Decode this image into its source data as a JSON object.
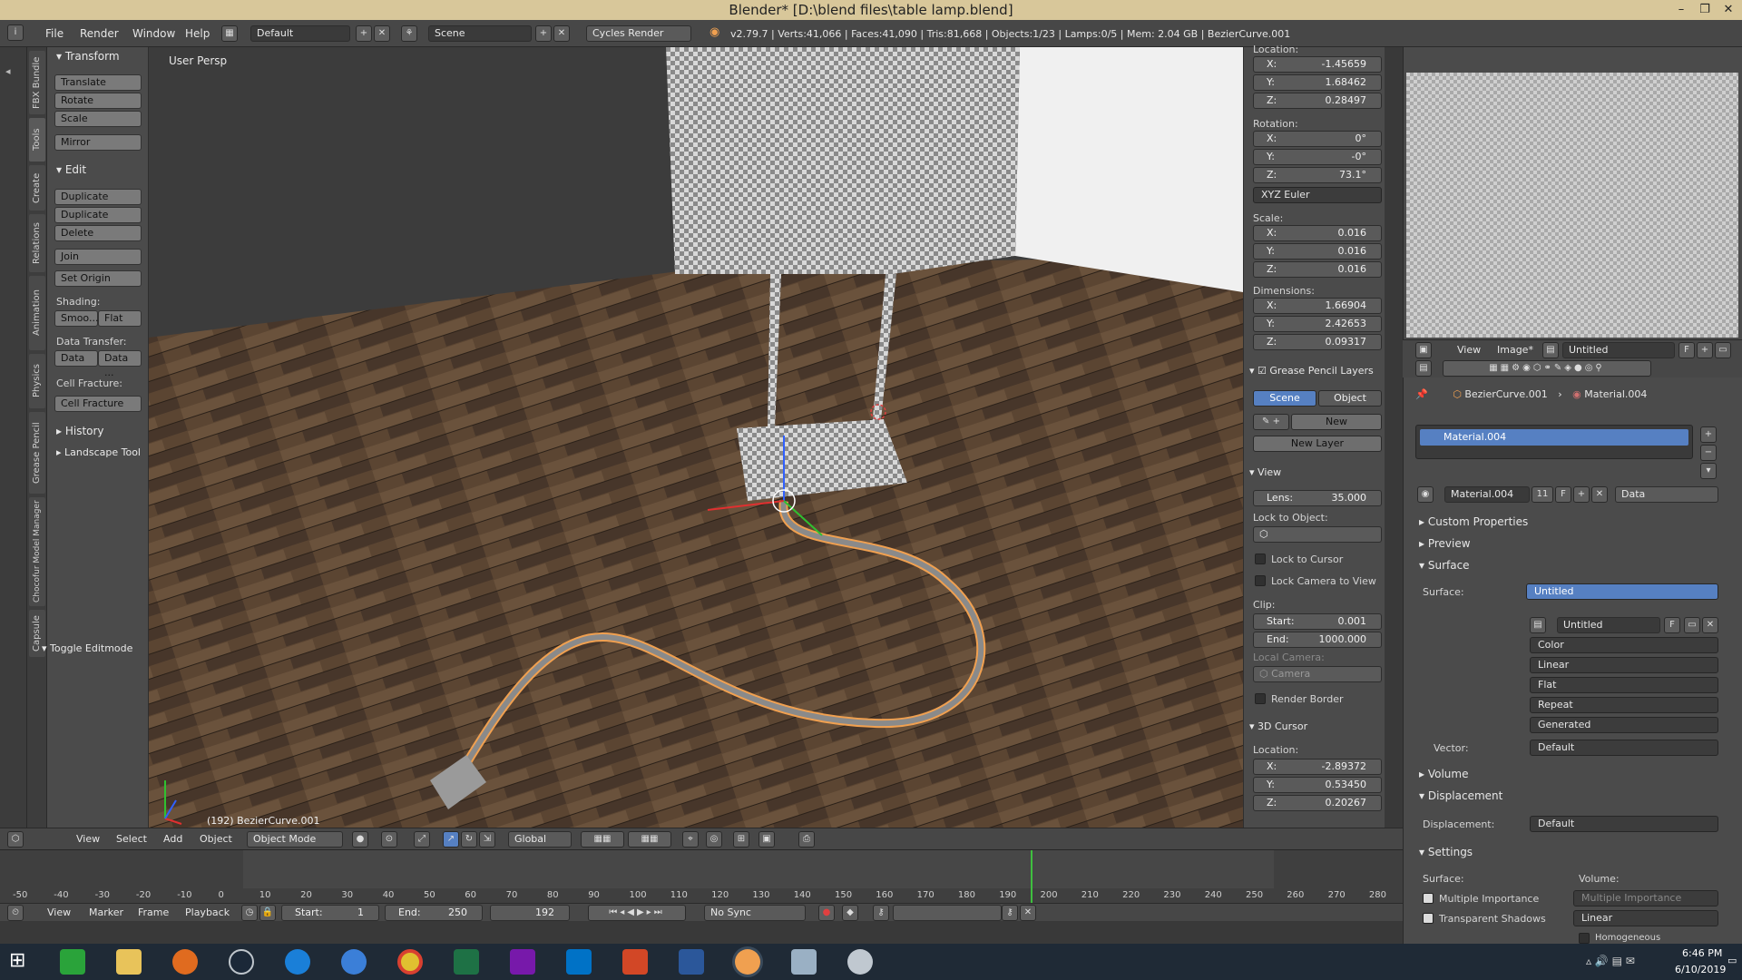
{
  "window": {
    "title": "Blender* [D:\\blend files\\table lamp.blend]"
  },
  "info_header": {
    "menus": [
      "File",
      "Render",
      "Window",
      "Help"
    ],
    "screen_layout": "Default",
    "scene": "Scene",
    "render_engine": "Cycles Render",
    "stats": "v2.79.7 | Verts:41,066 | Faces:41,090 | Tris:81,668 | Objects:1/23 | Lamps:0/5 | Mem: 2.04 GB | BezierCurve.001"
  },
  "vertical_tabs": [
    "FBX Bundle",
    "Tools",
    "Create",
    "Relations",
    "Animation",
    "Physics",
    "Grease Pencil",
    "Chocofur Model Manager",
    "Capsule"
  ],
  "tool_shelf": {
    "transform": {
      "title": "Transform",
      "buttons": [
        "Translate",
        "Rotate",
        "Scale",
        "Mirror"
      ]
    },
    "edit": {
      "title": "Edit",
      "buttons": [
        "Duplicate",
        "Duplicate Linked",
        "Delete",
        "Join",
        "Set Origin"
      ],
      "shading_label": "Shading:",
      "shading": [
        "Smoo...",
        "Flat"
      ],
      "data_transfer_label": "Data Transfer:",
      "data_transfer": [
        "Data",
        "Data ..."
      ],
      "cell_fracture_label": "Cell Fracture:",
      "cell_fracture": "Cell Fracture"
    },
    "history": "History",
    "landscape": "Landscape Tool",
    "toggle_editmode": "Toggle Editmode"
  },
  "viewport": {
    "label": "User Persp",
    "object_label": "(192) BezierCurve.001"
  },
  "n_panel": {
    "location_label": "Location:",
    "location": [
      {
        "axis": "X:",
        "value": "-1.45659"
      },
      {
        "axis": "Y:",
        "value": "1.68462"
      },
      {
        "axis": "Z:",
        "value": "0.28497"
      }
    ],
    "rotation_label": "Rotation:",
    "rotation": [
      {
        "axis": "X:",
        "value": "0°"
      },
      {
        "axis": "Y:",
        "value": "-0°"
      },
      {
        "axis": "Z:",
        "value": "73.1°"
      }
    ],
    "rotation_mode": "XYZ Euler",
    "scale_label": "Scale:",
    "scale": [
      {
        "axis": "X:",
        "value": "0.016"
      },
      {
        "axis": "Y:",
        "value": "0.016"
      },
      {
        "axis": "Z:",
        "value": "0.016"
      }
    ],
    "dimensions_label": "Dimensions:",
    "dimensions": [
      {
        "axis": "X:",
        "value": "1.66904"
      },
      {
        "axis": "Y:",
        "value": "2.42653"
      },
      {
        "axis": "Z:",
        "value": "0.09317"
      }
    ],
    "grease_pencil": {
      "title": "Grease Pencil Layers",
      "tabs": [
        "Scene",
        "Object"
      ],
      "new": "New",
      "new_layer": "New Layer"
    },
    "view": {
      "title": "View",
      "lens_label": "Lens:",
      "lens": "35.000",
      "lock_to_object": "Lock to Object:",
      "lock_to_cursor": "Lock to Cursor",
      "lock_camera": "Lock Camera to View",
      "clip_label": "Clip:",
      "clip_start_label": "Start:",
      "clip_start": "0.001",
      "clip_end_label": "End:",
      "clip_end": "1000.000",
      "local_camera_label": "Local Camera:",
      "local_camera": "Camera",
      "render_border": "Render Border"
    },
    "cursor": {
      "title": "3D Cursor",
      "location_label": "Location:",
      "location": [
        {
          "axis": "X:",
          "value": "-2.89372"
        },
        {
          "axis": "Y:",
          "value": "0.53450"
        },
        {
          "axis": "Z:",
          "value": "0.20267"
        }
      ]
    }
  },
  "viewport_header": {
    "menus": [
      "View",
      "Select",
      "Add",
      "Object"
    ],
    "mode": "Object Mode",
    "orientation": "Global"
  },
  "timeline": {
    "ticks": [
      "-50",
      "-40",
      "-30",
      "-20",
      "-10",
      "0",
      "10",
      "20",
      "30",
      "40",
      "50",
      "60",
      "70",
      "80",
      "90",
      "100",
      "110",
      "120",
      "130",
      "140",
      "150",
      "160",
      "170",
      "180",
      "190",
      "200",
      "210",
      "220",
      "230",
      "240",
      "250",
      "260",
      "270",
      "280"
    ],
    "menus": [
      "View",
      "Marker",
      "Frame",
      "Playback"
    ],
    "start_label": "Start:",
    "start": "1",
    "end_label": "End:",
    "end": "250",
    "current": "192",
    "sync": "No Sync"
  },
  "image_editor": {
    "menus": [
      "View",
      "Image*"
    ],
    "image": "Untitled"
  },
  "properties": {
    "breadcrumb": [
      "BezierCurve.001",
      "Material.004"
    ],
    "slot": "Material.004",
    "material": "Material.004",
    "users": "11",
    "link": "Data",
    "panels": {
      "custom_properties": "Custom Properties",
      "preview": "Preview",
      "surface": "Surface",
      "volume": "Volume",
      "displacement": "Displacement",
      "settings": "Settings"
    },
    "surface_label": "Surface:",
    "surface_value": "Untitled",
    "texture_name": "Untitled",
    "texture_options": [
      "Color",
      "Linear",
      "Flat",
      "Repeat",
      "Generated"
    ],
    "vector_label": "Vector:",
    "vector": "Default",
    "displacement_label": "Displacement:",
    "displacement": "Default",
    "settings_surface": "Surface:",
    "settings_volume": "Volume:",
    "multiple_importance": "Multiple Importance",
    "transparent_shadows": "Transparent Shadows",
    "volume_sampling": "Multiple Importance",
    "volume_interp": "Linear",
    "homogeneous": "Homogeneous"
  },
  "taskbar": {
    "time": "6:46 PM",
    "date": "6/10/2019"
  },
  "colors": {
    "accent_blue": "#5680c2",
    "selection_orange": "#f0a050",
    "cursor_red": "#e04040",
    "timeline_green": "#3fbf3f"
  }
}
